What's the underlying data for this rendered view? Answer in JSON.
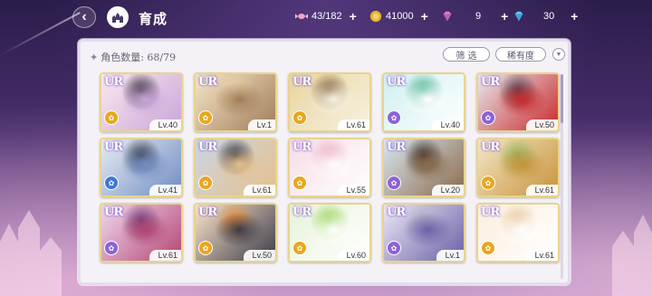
{
  "header": {
    "title": "育成",
    "back_icon": "back-arrow-icon",
    "home_icon": "castle-home-icon"
  },
  "resources": [
    {
      "name": "candy",
      "icon": "candy-icon",
      "value": "43/182",
      "color": "#f3a2c4"
    },
    {
      "name": "coin",
      "icon": "coin-icon",
      "value": "41000",
      "color": "#e8b22c"
    },
    {
      "name": "pink-gem",
      "icon": "pink-gem-icon",
      "value": "9",
      "color": "#e07ad6"
    },
    {
      "name": "blue-gem",
      "icon": "blue-gem-icon",
      "value": "30",
      "color": "#68c4ef"
    }
  ],
  "panel": {
    "count_label": "角色数量: 68/79",
    "filter_label": "筛 选",
    "rarity_label": "稀有度",
    "sort_icon": "chevron-down-icon"
  },
  "cards": [
    {
      "rarity": "UR",
      "level": "Lv.40",
      "attr_color": "#e7a71f",
      "palette": [
        "#fbe8ef",
        "#2b2430",
        "#c9a5d8"
      ]
    },
    {
      "rarity": "UR",
      "level": "Lv.1",
      "attr_color": "#e7a71f",
      "palette": [
        "#f6e6c9",
        "#e8cfa2",
        "#a07c58"
      ]
    },
    {
      "rarity": "UR",
      "level": "Lv.61",
      "attr_color": "#e7a71f",
      "palette": [
        "#e9d59f",
        "#7a5b3a",
        "#f7f1e1"
      ]
    },
    {
      "rarity": "UR",
      "level": "Lv.40",
      "attr_color": "#8c63d6",
      "palette": [
        "#cfeff0",
        "#3fae8a",
        "#ffffff"
      ]
    },
    {
      "rarity": "UR",
      "level": "Lv.50",
      "attr_color": "#8c63d6",
      "palette": [
        "#e7e9ef",
        "#4a4150",
        "#c9282a"
      ]
    },
    {
      "rarity": "UR",
      "level": "Lv.41",
      "attr_color": "#3f78d6",
      "palette": [
        "#e8ecf3",
        "#2f3442",
        "#6f8cc2"
      ]
    },
    {
      "rarity": "UR",
      "level": "Lv.61",
      "attr_color": "#e7a71f",
      "palette": [
        "#cbd6e6",
        "#24283a",
        "#e6c08a"
      ]
    },
    {
      "rarity": "UR",
      "level": "Lv.55",
      "attr_color": "#e7a71f",
      "palette": [
        "#f6dde6",
        "#e9a9bf",
        "#ffffff"
      ]
    },
    {
      "rarity": "UR",
      "level": "Lv.20",
      "attr_color": "#8c63d6",
      "palette": [
        "#d8e6f2",
        "#3a2a24",
        "#8a6a4a"
      ]
    },
    {
      "rarity": "UR",
      "level": "Lv.61",
      "attr_color": "#e7a71f",
      "palette": [
        "#f2e7c6",
        "#8fb35a",
        "#c7923a"
      ]
    },
    {
      "rarity": "UR",
      "level": "Lv.61",
      "attr_color": "#8c63d6",
      "palette": [
        "#f0d9ef",
        "#6c3a7a",
        "#b34572"
      ]
    },
    {
      "rarity": "UR",
      "level": "Lv.50",
      "attr_color": "#e7a71f",
      "palette": [
        "#fde6c8",
        "#ef8a2c",
        "#3a3a4a"
      ]
    },
    {
      "rarity": "UR",
      "level": "Lv.60",
      "attr_color": "#e7a71f",
      "palette": [
        "#e6f3d8",
        "#8fcf4a",
        "#ffffff"
      ]
    },
    {
      "rarity": "UR",
      "level": "Lv.1",
      "attr_color": "#8c63d6",
      "palette": [
        "#ece8f6",
        "#b7b3c9",
        "#6a5fa5"
      ]
    },
    {
      "rarity": "UR",
      "level": "Lv.61",
      "attr_color": "#e7a71f",
      "palette": [
        "#fbeede",
        "#e6c494",
        "#ffffff"
      ]
    }
  ]
}
